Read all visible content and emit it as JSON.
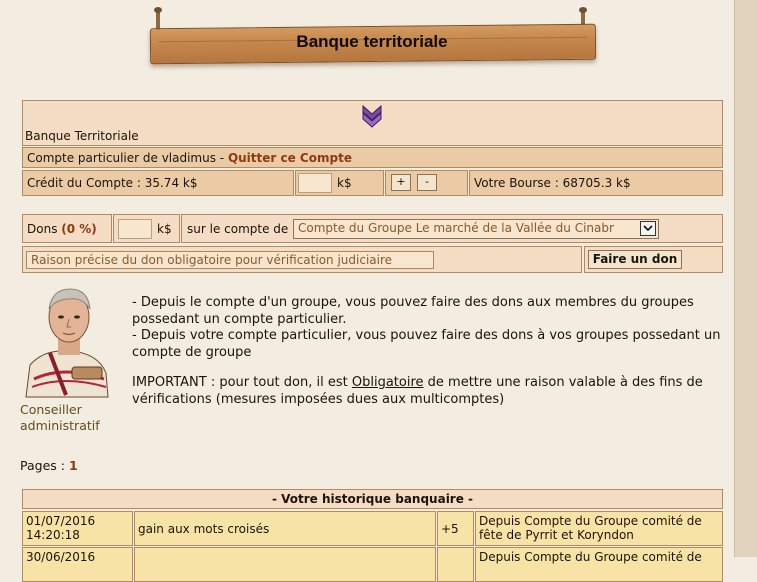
{
  "sign": {
    "title": "Banque territoriale"
  },
  "bank": {
    "name": "Banque Territoriale",
    "icon": "chevron-down-emblem-icon"
  },
  "account": {
    "prefix": "Compte particulier de vladimus - ",
    "quit_link": "Quitter ce Compte",
    "credit_label": "Crédit du Compte : 35.74 k$",
    "amount_value": "",
    "currency": "k$",
    "plus": "+",
    "minus": "-",
    "purse_label": "Votre Bourse : 68705.3 k$"
  },
  "donation": {
    "label": "Dons ",
    "percent": "(0 %)",
    "amount_value": "",
    "currency": "k$",
    "target_label": "sur le compte de",
    "target_selected": "Compte du Groupe Le marché de la Vallée du Cinabr",
    "reason_placeholder": "Raison précise du don obligatoire pour vérification judiciaire",
    "submit": "Faire un don"
  },
  "advisor": {
    "name": "Conseiller administratif"
  },
  "info": {
    "line1": "- Depuis le compte d'un groupe, vous pouvez faire des dons aux membres du groupes possedant un compte particulier.",
    "line2": "- Depuis votre compte particulier, vous pouvez faire des dons à vos groupes possedant un compte de groupe",
    "important_a": "IMPORTANT : pour tout don, il est ",
    "important_link": "Obligatoire",
    "important_b": " de mettre une raison valable à des fins de vérifications (mesures imposées dues aux multicomptes)"
  },
  "pages": {
    "label": "Pages : ",
    "current": "1"
  },
  "history": {
    "title": "- Votre historique banquaire -",
    "rows": [
      {
        "date": "01/07/2016",
        "time": "14:20:18",
        "reason": "gain aux mots croisés",
        "amount": "+5",
        "source": "Depuis Compte du Groupe comité de fête de Pyrrit et Koryndon"
      },
      {
        "date": "30/06/2016",
        "time": "",
        "reason": "",
        "amount": "",
        "source": "Depuis Compte du Groupe comité de"
      }
    ]
  },
  "colors": {
    "panel": "#f5dcc4",
    "border": "#b38a5d",
    "row": "#f8e3a6",
    "link": "#8e3a0e",
    "background": "#f3ece0"
  }
}
